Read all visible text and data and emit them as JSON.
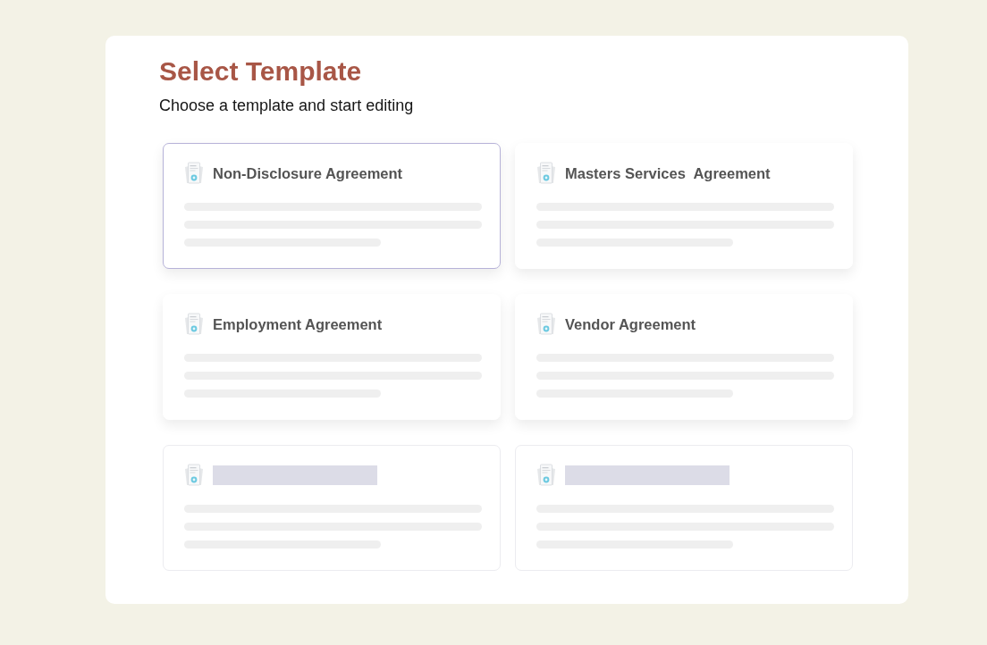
{
  "header": {
    "title": "Select Template",
    "subtitle": "Choose a template and start editing"
  },
  "cards": [
    {
      "kind": "template",
      "title": "Non-Disclosure Agreement",
      "selected": true
    },
    {
      "kind": "template",
      "title": "Masters Services  Agreement",
      "selected": false
    },
    {
      "kind": "template",
      "title": "Employment Agreement",
      "selected": false
    },
    {
      "kind": "template",
      "title": "Vendor Agreement",
      "selected": false
    },
    {
      "kind": "skeleton",
      "selected": false
    },
    {
      "kind": "skeleton",
      "selected": false
    }
  ]
}
